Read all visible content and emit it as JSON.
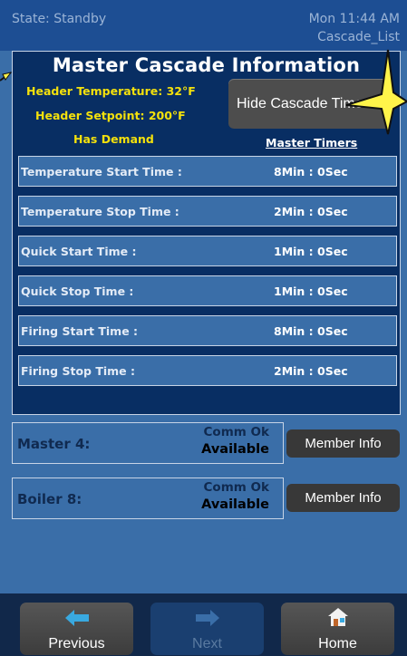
{
  "status_bar": {
    "state": "State: Standby",
    "datetime": "Mon 11:44 AM",
    "screen_name": "Cascade_List"
  },
  "cascade_panel": {
    "title": "Master Cascade Information",
    "header_temperature": "Header Temperature: 32°F",
    "header_setpoint": "Header Setpoint: 200°F",
    "demand": "Has Demand",
    "hide_button": "Hide Cascade Timers",
    "master_timers_label": "Master Timers",
    "timers": [
      {
        "label": "Temperature Start Time :",
        "value": "8Min : 0Sec"
      },
      {
        "label": "Temperature Stop Time :",
        "value": "2Min : 0Sec"
      },
      {
        "label": "Quick Start Time :",
        "value": "1Min : 0Sec"
      },
      {
        "label": "Quick Stop Time :",
        "value": "1Min : 0Sec"
      },
      {
        "label": "Firing Start Time :",
        "value": "8Min : 0Sec"
      },
      {
        "label": "Firing Stop Time :",
        "value": "2Min : 0Sec"
      }
    ]
  },
  "members": [
    {
      "name": "Master 4:",
      "comm": "Comm Ok",
      "availability": "Available",
      "button": "Member Info"
    },
    {
      "name": "Boiler 8:",
      "comm": "Comm Ok",
      "availability": "Available",
      "button": "Member Info"
    }
  ],
  "nav": {
    "previous": "Previous",
    "next": "Next",
    "home": "Home"
  },
  "colors": {
    "header_text": "#f4e10c",
    "panel_bg": "#082e63",
    "screen_bg": "#3a6ea8",
    "highlight_star": "#fff44a"
  }
}
